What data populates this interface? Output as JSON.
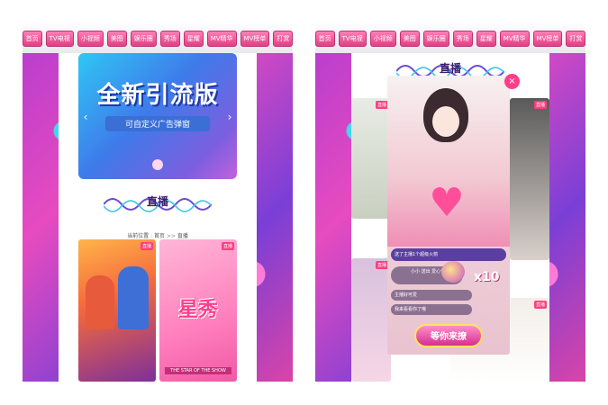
{
  "nav": {
    "left": [
      "首页",
      "TV电视",
      "小视频",
      "美图",
      "娱乐圈",
      "秀场",
      "星耀",
      "MV精华",
      "MV榜单",
      "打赏"
    ],
    "right": [
      "首页",
      "TV电视",
      "小视频",
      "美图",
      "娱乐圈",
      "秀场",
      "星耀",
      "MV精华",
      "MV榜单",
      "打赏"
    ]
  },
  "left_panel": {
    "banner": {
      "title": "全新引流版",
      "subtitle": "可自定义广告弹窗"
    },
    "section_title": "直播",
    "breadcrumb": {
      "home": "当前位置",
      "current": "首页",
      "sep": ">>",
      "page": "直播"
    },
    "cards": [
      {
        "badge": "直播"
      },
      {
        "badge": "直播",
        "title": "星秀",
        "subtitle": "THE STAR OF THE SHOW"
      }
    ]
  },
  "right_panel": {
    "section_title": "直播",
    "cards": [
      {
        "badge": "直播"
      },
      {
        "badge": "直播"
      },
      {
        "badge": "直播"
      },
      {
        "badge": "直播"
      }
    ],
    "modal": {
      "close_icon": "×",
      "gift_banner": "送了主播1个超级火箭",
      "user_label": "小小 送出 爱心气球",
      "gift_count": "x10",
      "comment1": "主播好可爱",
      "comment2": "我来看看你了哦",
      "cta_label": "等你来撩"
    }
  },
  "colors": {
    "accent": "#e23f86",
    "banner": "#3e7bea",
    "panel_bg": "#d63bb5"
  }
}
